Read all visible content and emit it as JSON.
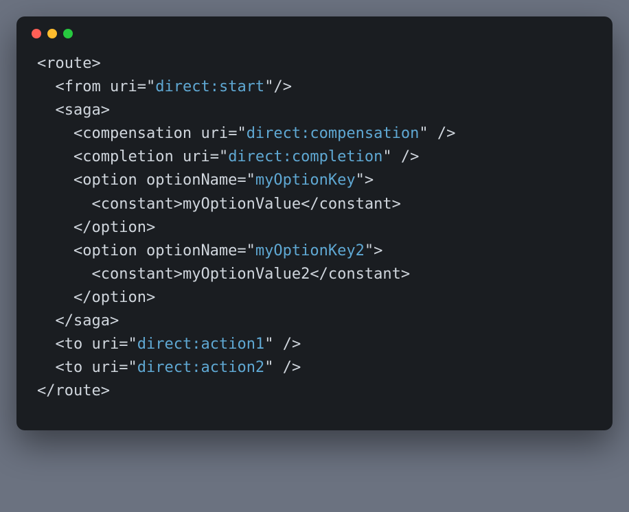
{
  "colors": {
    "bg_page": "#6b7280",
    "bg_window": "#1a1d21",
    "fg_default": "#d0d6dd",
    "fg_string": "#5fa8d3",
    "dot_red": "#ff5f56",
    "dot_yellow": "#ffbd2e",
    "dot_green": "#27c93f"
  },
  "tokens": {
    "lt": "<",
    "gt": ">",
    "slash": "/",
    "eq": "=",
    "q": "\"",
    "sp": " ",
    "route": "route",
    "from": "from",
    "saga": "saga",
    "compensation": "compensation",
    "completion": "completion",
    "option": "option",
    "constant": "constant",
    "to": "to",
    "uri": "uri",
    "optionName": "optionName",
    "val_direct_start": "direct:start",
    "val_direct_compensation": "direct:compensation",
    "val_direct_completion": "direct:completion",
    "val_myOptionKey": "myOptionKey",
    "val_myOptionKey2": "myOptionKey2",
    "val_direct_action1": "direct:action1",
    "val_direct_action2": "direct:action2",
    "txt_myOptionValue": "myOptionValue",
    "txt_myOptionValue2": "myOptionValue2"
  }
}
